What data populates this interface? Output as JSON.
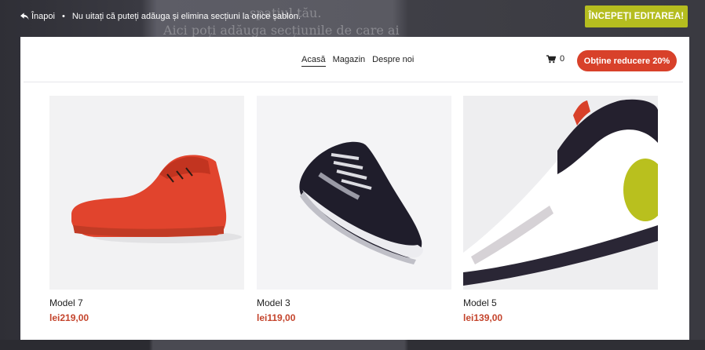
{
  "topbar": {
    "back_label": "Înapoi",
    "separator": "•",
    "notice": "Nu uitați că puteți adăuga și elimina secțiuni la orice șablon.",
    "start_button": "ÎNCEPEȚI EDITAREA!"
  },
  "background_text": {
    "line1": "spațiul tău.",
    "line2": "Aici poți adăuga secțiunile de care ai nevoie"
  },
  "header": {
    "nav": [
      {
        "label": "Acasă",
        "active": true
      },
      {
        "label": "Magazin",
        "active": false
      },
      {
        "label": "Despre noi",
        "active": false
      }
    ],
    "cart_count": "0",
    "promo_button": "Obține reducere 20%"
  },
  "products": [
    {
      "name": "Model 7",
      "price": "lei219,00",
      "image": "red-high-top-sneaker"
    },
    {
      "name": "Model 3",
      "price": "lei119,00",
      "image": "black-white-runner-sneaker"
    },
    {
      "name": "Model 5",
      "price": "lei139,00",
      "image": "white-lime-runner-closeup"
    }
  ],
  "colors": {
    "accent_green": "#b5bd1f",
    "promo_red": "#d8412a",
    "price_red": "#c4442c"
  }
}
